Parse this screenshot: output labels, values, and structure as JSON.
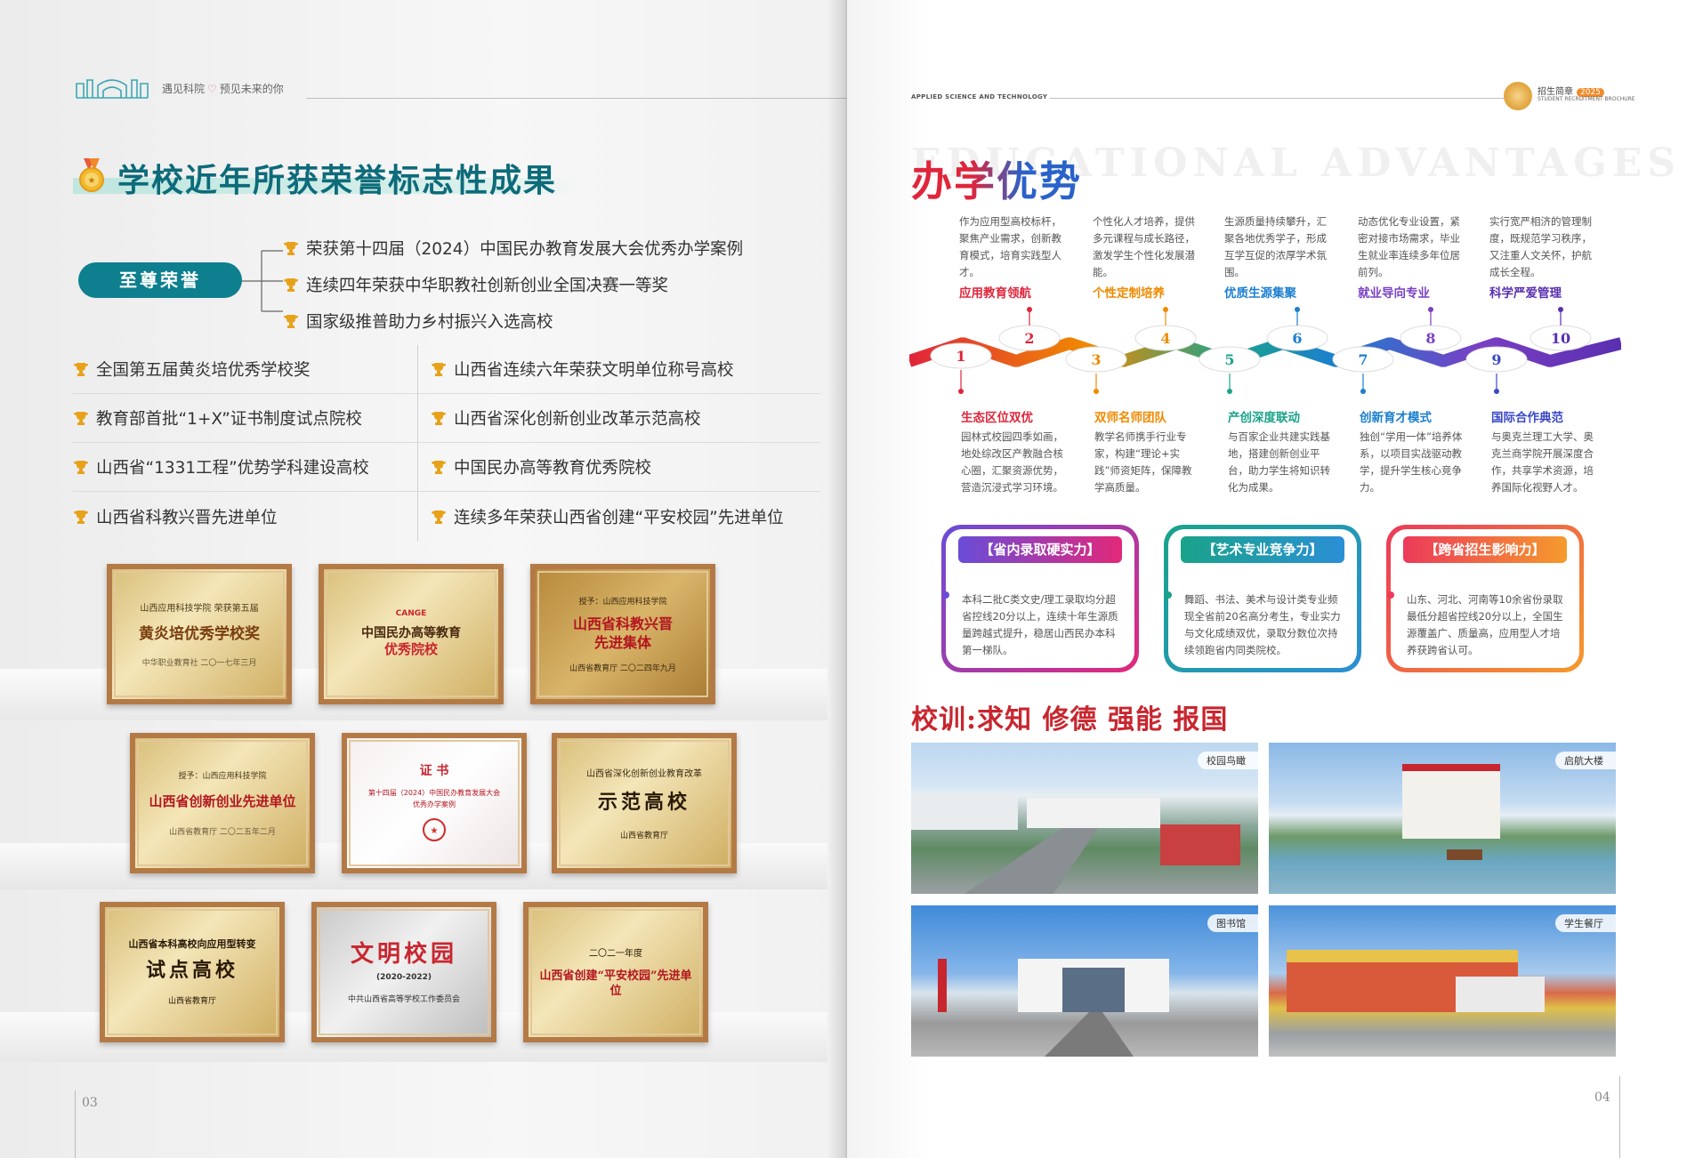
{
  "left_page": {
    "header": {
      "tagline_part1": "遇见科院",
      "tagline_part2": "预见未来的你"
    },
    "section_title": "学校近年所获荣誉标志性成果",
    "supreme_label": "至尊荣誉",
    "supreme_items": [
      "荣获第十四届（2024）中国民办教育发展大会优秀办学案例",
      "连续四年荣获中华职教社创新创业全国决赛一等奖",
      "国家级推普助力乡村振兴入选高校"
    ],
    "honors": [
      [
        "全国第五届黄炎培优秀学校奖",
        "山西省连续六年荣获文明单位称号高校"
      ],
      [
        "教育部首批“1+X”证书制度试点院校",
        "山西省深化创新创业改革示范高校"
      ],
      [
        "山西省“1331工程”优势学科建设高校",
        "中国民办高等教育优秀院校"
      ],
      [
        "山西省科教兴晋先进单位",
        "连续多年荣获山西省创建“平安校园”先进单位"
      ]
    ],
    "plaques": [
      {
        "top": "山西应用科技学院 荣获第五届",
        "main": "黄炎培优秀学校奖",
        "sub": "中华职业教育社 二〇一七年三月"
      },
      {
        "top": "CANGE",
        "main": "中国民办高等教育",
        "main2": "优秀院校",
        "sub": ""
      },
      {
        "top": "授予：山西应用科技学院",
        "main": "山西省科教兴晋",
        "main2": "先进集体",
        "sub": "山西省教育厅 二〇二四年九月"
      },
      {
        "top": "授予：山西应用科技学院",
        "main": "山西省创新创业先进单位",
        "sub": "山西省教育厅 二〇二五年二月"
      },
      {
        "top": "证 书",
        "main": "第十四届（2024）中国民办教育发展大会",
        "main2": "优秀办学案例",
        "sub": ""
      },
      {
        "top": "山西省深化创新创业教育改革",
        "main": "示范高校",
        "sub": "山西省教育厅"
      },
      {
        "top": "山西省本科高校向应用型转变",
        "main": "试点高校",
        "sub": "山西省教育厅"
      },
      {
        "top": "",
        "main": "文明校园",
        "main2": "(2020-2022)",
        "sub": "中共山西省高等学校工作委员会"
      },
      {
        "top": "二〇二一年度",
        "main": "山西省创建“平安校园”先进单位",
        "sub": ""
      }
    ],
    "page_number": "03"
  },
  "right_page": {
    "header": {
      "en": "APPLIED SCIENCE AND TECHNOLOGY",
      "brochure": "招生简章",
      "year": "2025",
      "brochure_en": "STUDENT RECRUITMENT BROCHURE"
    },
    "bg_title": "EDUCATIONAL ADVANTAGES",
    "title": "办学优势",
    "advantages_top": [
      {
        "num": "2",
        "name": "应用教育领航",
        "color": "#e0253b",
        "desc": "作为应用型高校标杆，聚焦产业需求，创新教育模式，培育实践型人才。"
      },
      {
        "num": "4",
        "name": "个性定制培养",
        "color": "#f08a00",
        "desc": "个性化人才培养，提供多元课程与成长路径，激发学生个性化发展潜能。"
      },
      {
        "num": "6",
        "name": "优质生源集聚",
        "color": "#1a7fd0",
        "desc": "生源质量持续攀升，汇聚各地优秀学子，形成互学互促的浓厚学术氛围。"
      },
      {
        "num": "8",
        "name": "就业导向专业",
        "color": "#7a3fc4",
        "desc": "动态优化专业设置，紧密对接市场需求，毕业生就业率连续多年位居前列。"
      },
      {
        "num": "10",
        "name": "科学严爱管理",
        "color": "#5a2fb0",
        "desc": "实行宽严相济的管理制度，既规范学习秩序，又注重人文关怀，护航成长全程。"
      }
    ],
    "advantages_bottom": [
      {
        "num": "1",
        "name": "生态区位双优",
        "color": "#e0253b",
        "desc": "园林式校园四季如画，地处综改区产教融合核心圈，汇聚资源优势，营造沉浸式学习环境。"
      },
      {
        "num": "3",
        "name": "双师名师团队",
        "color": "#f08a00",
        "desc": "教学名师携手行业专家，构建“理论+实践”师资矩阵，保障教学高质量。"
      },
      {
        "num": "5",
        "name": "产创深度联动",
        "color": "#1aa38a",
        "desc": "与百家企业共建实践基地，搭建创新创业平台，助力学生将知识转化为成果。"
      },
      {
        "num": "7",
        "name": "创新育才模式",
        "color": "#1a7fd0",
        "desc": "独创“学用一体”培养体系，以项目实战驱动教学，提升学生核心竞争力。"
      },
      {
        "num": "9",
        "name": "国际合作典范",
        "color": "#3a49c8",
        "desc": "与奥克兰理工大学、奥克兰商学院开展深度合作，共享学术资源，培养国际化视野人才。"
      }
    ],
    "cards": [
      {
        "title": "【省内录取硬实力】",
        "body": "本科二批C类文史/理工录取均分超省控线20分以上，连续十年生源质量跨越式提升，稳居山西民办本科第一梯队。"
      },
      {
        "title": "【艺术专业竞争力】",
        "body": "舞蹈、书法、美术与设计类专业频现全省前20名高分考生，专业实力与文化成绩双优，录取分数位次持续领跑省内同类院校。"
      },
      {
        "title": "【跨省招生影响力】",
        "body": "山东、河北、河南等10余省份录取最低分超省控线20分以上，全国生源覆盖广、质量高，应用型人才培养获跨省认可。"
      }
    ],
    "motto": "校训:求知 修德 强能 报国",
    "photos": [
      "校园鸟瞰",
      "启航大楼",
      "图书馆",
      "学生餐厅"
    ],
    "page_number": "04"
  },
  "colors": {
    "teal": "#0d7f8e",
    "title_teal": "#0d6b7a",
    "red": "#c8262f",
    "trophy": "#e8a21a"
  },
  "icons": {
    "trophy": "trophy-icon",
    "medal": "medal-icon",
    "gate": "school-gate-logo-icon",
    "heart": "heart-icon"
  }
}
